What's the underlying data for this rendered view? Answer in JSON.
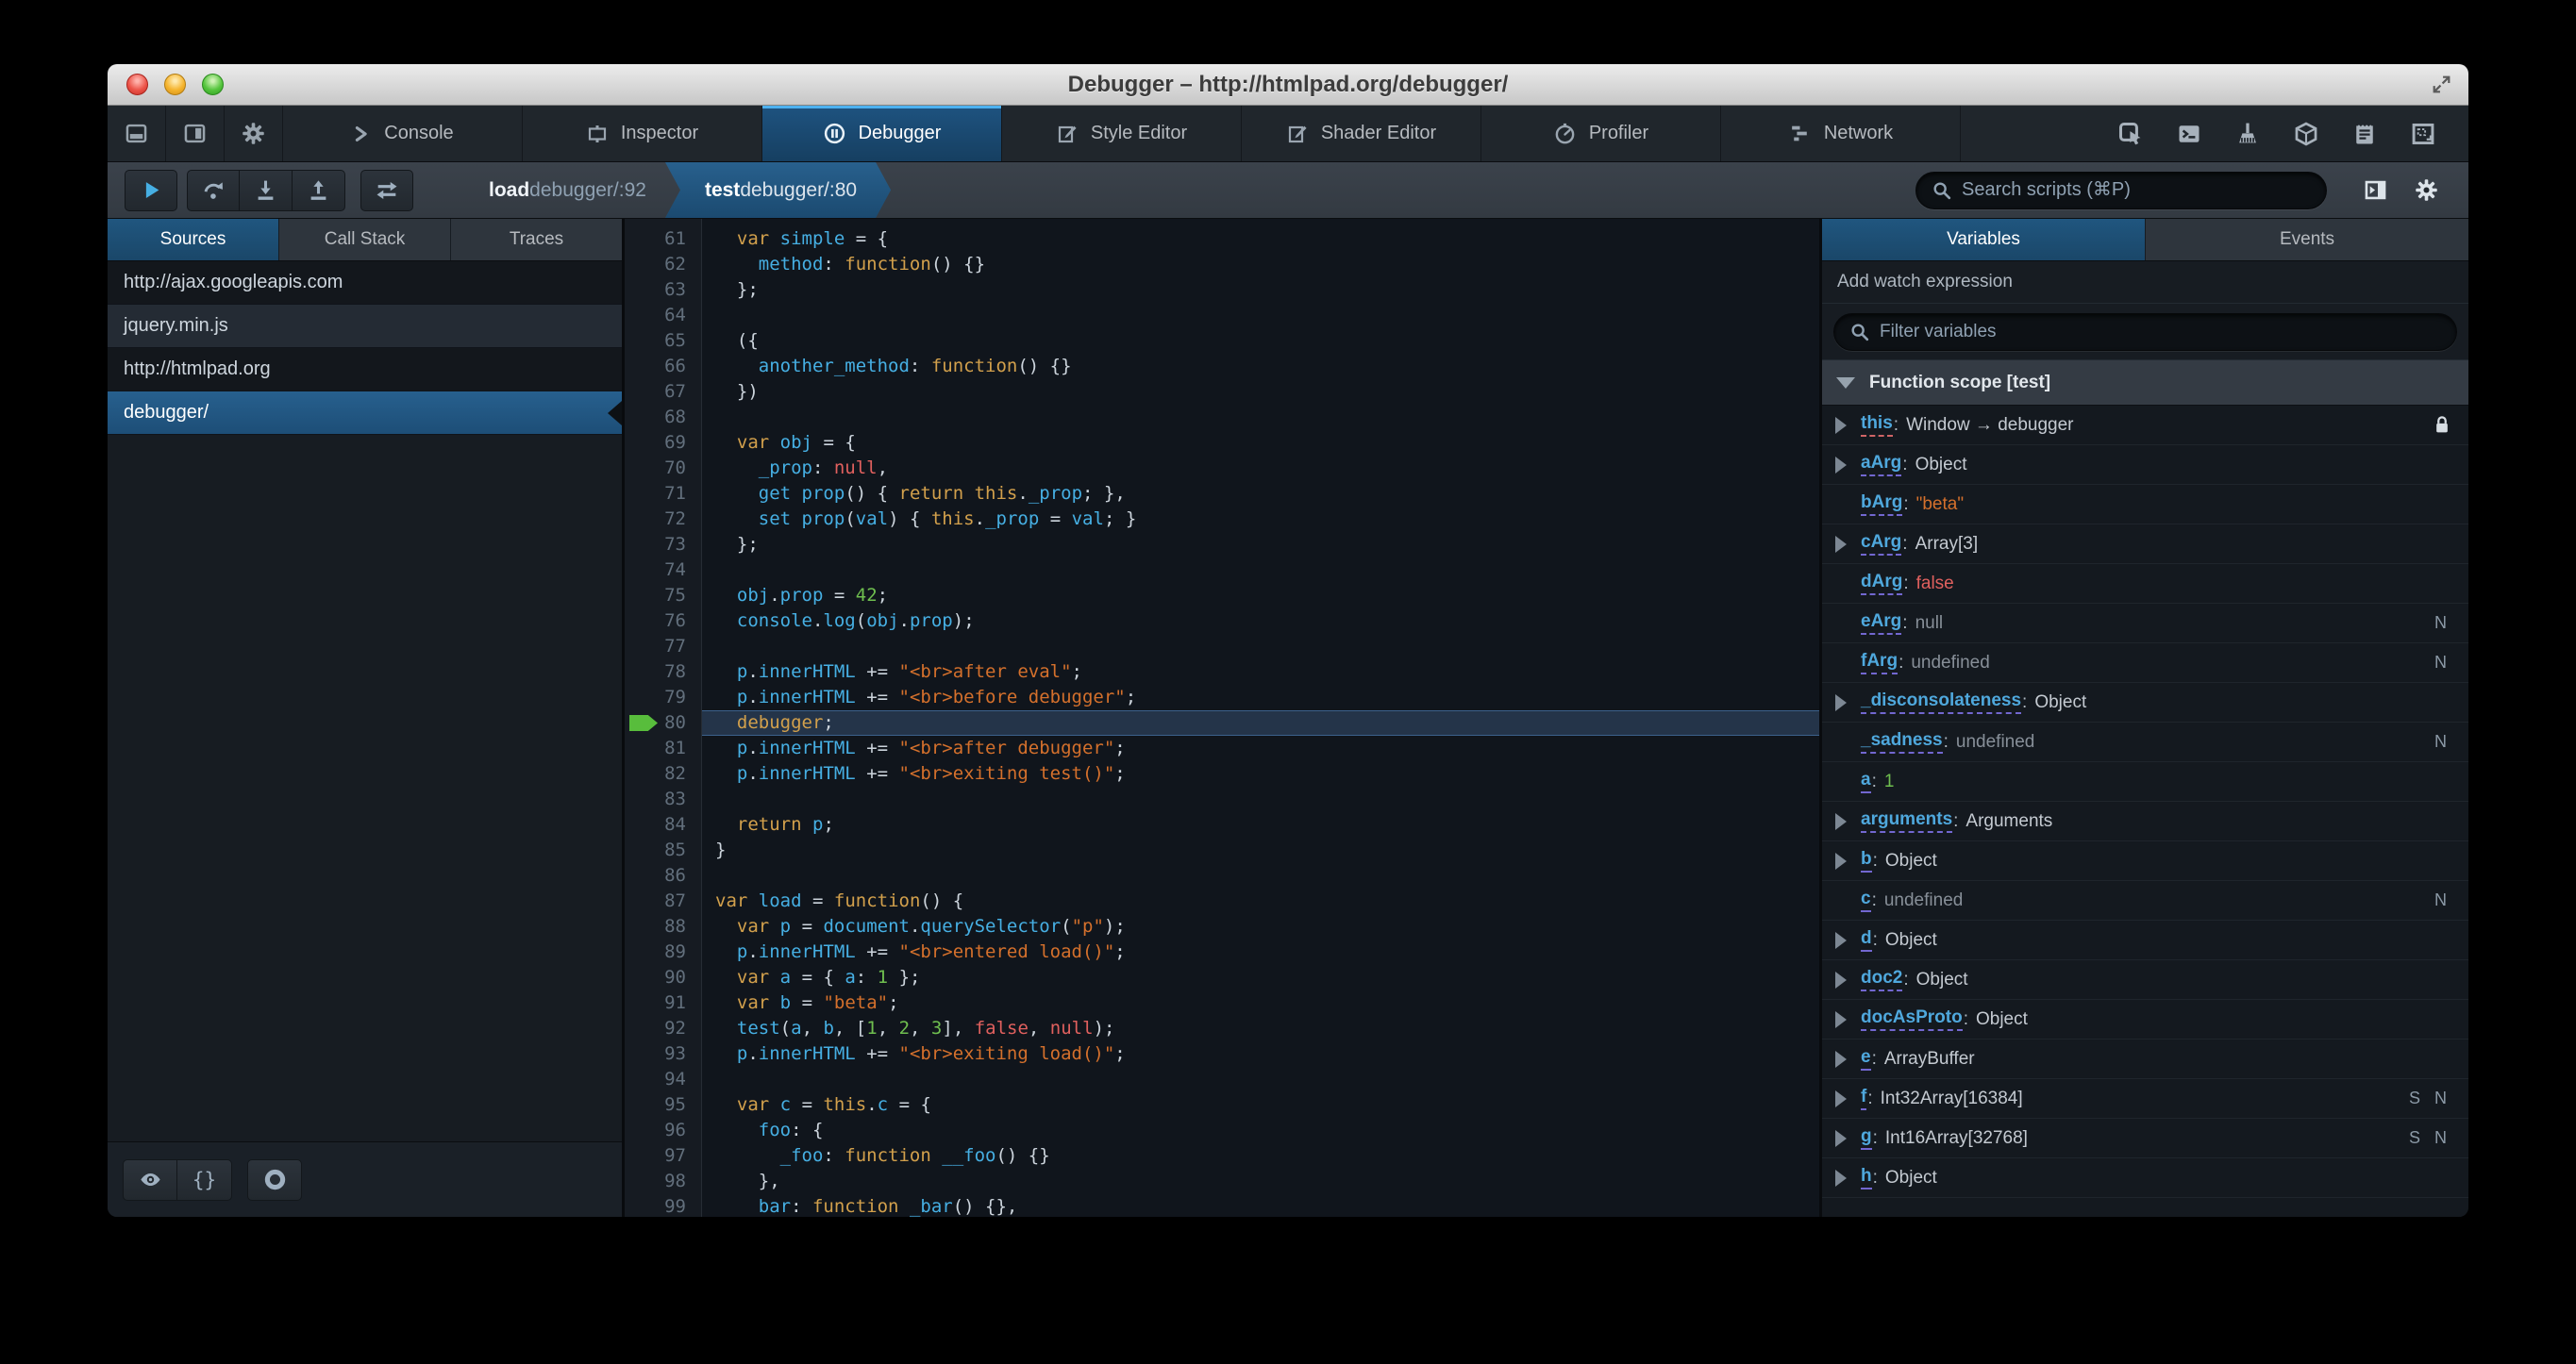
{
  "window": {
    "title": "Debugger – http://htmlpad.org/debugger/"
  },
  "colors": {
    "accent_blue": "#46afe3",
    "selection_blue": "#1d4f73",
    "active_tab_stripe": "#4cb1f0",
    "keyword": "#d2a04c",
    "identifier": "#46afe3",
    "string": "#d4702c",
    "atom": "#e0605e",
    "number": "#6fbf4f",
    "breakpoint_arrow_green": "#58bd3c",
    "editor_bg": "#10151c"
  },
  "toolbox": {
    "left_buttons": [
      {
        "name": "dock-bottom-button",
        "icon": "dock-bottom-icon"
      },
      {
        "name": "dock-side-button",
        "icon": "dock-side-icon"
      },
      {
        "name": "toolbox-options-button",
        "icon": "gear-icon"
      }
    ],
    "tabs": [
      {
        "label": "Console",
        "icon": "console-icon",
        "active": false
      },
      {
        "label": "Inspector",
        "icon": "inspector-icon",
        "active": false
      },
      {
        "label": "Debugger",
        "icon": "debugger-icon",
        "active": true
      },
      {
        "label": "Style Editor",
        "icon": "style-editor-icon",
        "active": false
      },
      {
        "label": "Shader Editor",
        "icon": "shader-editor-icon",
        "active": false
      },
      {
        "label": "Profiler",
        "icon": "profiler-icon",
        "active": false
      },
      {
        "label": "Network",
        "icon": "network-icon",
        "active": false
      }
    ],
    "right_buttons": [
      {
        "name": "element-picker-button",
        "icon": "element-picker-icon"
      },
      {
        "name": "split-console-button",
        "icon": "split-console-icon"
      },
      {
        "name": "paintbrush-button",
        "icon": "paintbrush-icon"
      },
      {
        "name": "tilt-3d-button",
        "icon": "cube-icon"
      },
      {
        "name": "scratchpad-button",
        "icon": "scratchpad-icon"
      },
      {
        "name": "responsive-mode-button",
        "icon": "responsive-icon"
      }
    ]
  },
  "debugger_toolbar": {
    "breadcrumbs": [
      {
        "fn": "load",
        "loc": " debugger/:92",
        "active": false
      },
      {
        "fn": "test",
        "loc": " debugger/:80",
        "active": true
      }
    ],
    "search_placeholder": "Search scripts (⌘P)"
  },
  "sources_panel": {
    "tabs": [
      {
        "label": "Sources",
        "active": true
      },
      {
        "label": "Call Stack",
        "active": false
      },
      {
        "label": "Traces",
        "active": false
      }
    ],
    "items": [
      {
        "label": "http://ajax.googleapis.com",
        "kind": "group",
        "selected": false
      },
      {
        "label": "jquery.min.js",
        "kind": "item",
        "selected": false
      },
      {
        "label": "http://htmlpad.org",
        "kind": "group",
        "selected": false
      },
      {
        "label": "debugger/",
        "kind": "item",
        "selected": true
      }
    ]
  },
  "editor": {
    "first_line": 61,
    "current_line": 80,
    "lines": [
      [
        [
          "t",
          "  "
        ],
        [
          "k",
          "var"
        ],
        [
          "t",
          " "
        ],
        [
          "d",
          "simple"
        ],
        [
          "t",
          " = {"
        ]
      ],
      [
        [
          "t",
          "    "
        ],
        [
          "d",
          "method"
        ],
        [
          "t",
          ": "
        ],
        [
          "k",
          "function"
        ],
        [
          "t",
          "() {}"
        ]
      ],
      [
        [
          "t",
          "  };"
        ]
      ],
      [],
      [
        [
          "t",
          "  ({"
        ]
      ],
      [
        [
          "t",
          "    "
        ],
        [
          "d",
          "another_method"
        ],
        [
          "t",
          ": "
        ],
        [
          "k",
          "function"
        ],
        [
          "t",
          "() {}"
        ]
      ],
      [
        [
          "t",
          "  })"
        ]
      ],
      [],
      [
        [
          "t",
          "  "
        ],
        [
          "k",
          "var"
        ],
        [
          "t",
          " "
        ],
        [
          "d",
          "obj"
        ],
        [
          "t",
          " = {"
        ]
      ],
      [
        [
          "t",
          "    "
        ],
        [
          "d",
          "_prop"
        ],
        [
          "t",
          ": "
        ],
        [
          "a",
          "null"
        ],
        [
          "t",
          ","
        ]
      ],
      [
        [
          "t",
          "    "
        ],
        [
          "d",
          "get"
        ],
        [
          "t",
          " "
        ],
        [
          "d",
          "prop"
        ],
        [
          "t",
          "() { "
        ],
        [
          "k",
          "return"
        ],
        [
          "t",
          " "
        ],
        [
          "k",
          "this"
        ],
        [
          "t",
          "."
        ],
        [
          "d",
          "_prop"
        ],
        [
          "t",
          "; },"
        ]
      ],
      [
        [
          "t",
          "    "
        ],
        [
          "d",
          "set"
        ],
        [
          "t",
          " "
        ],
        [
          "d",
          "prop"
        ],
        [
          "t",
          "("
        ],
        [
          "d",
          "val"
        ],
        [
          "t",
          ") { "
        ],
        [
          "k",
          "this"
        ],
        [
          "t",
          "."
        ],
        [
          "d",
          "_prop"
        ],
        [
          "t",
          " = "
        ],
        [
          "d",
          "val"
        ],
        [
          "t",
          "; }"
        ]
      ],
      [
        [
          "t",
          "  };"
        ]
      ],
      [],
      [
        [
          "t",
          "  "
        ],
        [
          "d",
          "obj"
        ],
        [
          "t",
          "."
        ],
        [
          "d",
          "prop"
        ],
        [
          "t",
          " = "
        ],
        [
          "n",
          "42"
        ],
        [
          "t",
          ";"
        ]
      ],
      [
        [
          "t",
          "  "
        ],
        [
          "d",
          "console"
        ],
        [
          "t",
          "."
        ],
        [
          "d",
          "log"
        ],
        [
          "t",
          "("
        ],
        [
          "d",
          "obj"
        ],
        [
          "t",
          "."
        ],
        [
          "d",
          "prop"
        ],
        [
          "t",
          ");"
        ]
      ],
      [],
      [
        [
          "t",
          "  "
        ],
        [
          "d",
          "p"
        ],
        [
          "t",
          "."
        ],
        [
          "d",
          "innerHTML"
        ],
        [
          "t",
          " += "
        ],
        [
          "s",
          "\"<br>after eval\""
        ],
        [
          "t",
          ";"
        ]
      ],
      [
        [
          "t",
          "  "
        ],
        [
          "d",
          "p"
        ],
        [
          "t",
          "."
        ],
        [
          "d",
          "innerHTML"
        ],
        [
          "t",
          " += "
        ],
        [
          "s",
          "\"<br>before debugger\""
        ],
        [
          "t",
          ";"
        ]
      ],
      [
        [
          "t",
          "  "
        ],
        [
          "k",
          "debugger"
        ],
        [
          "t",
          ";"
        ]
      ],
      [
        [
          "t",
          "  "
        ],
        [
          "d",
          "p"
        ],
        [
          "t",
          "."
        ],
        [
          "d",
          "innerHTML"
        ],
        [
          "t",
          " += "
        ],
        [
          "s",
          "\"<br>after debugger\""
        ],
        [
          "t",
          ";"
        ]
      ],
      [
        [
          "t",
          "  "
        ],
        [
          "d",
          "p"
        ],
        [
          "t",
          "."
        ],
        [
          "d",
          "innerHTML"
        ],
        [
          "t",
          " += "
        ],
        [
          "s",
          "\"<br>exiting test()\""
        ],
        [
          "t",
          ";"
        ]
      ],
      [],
      [
        [
          "t",
          "  "
        ],
        [
          "k",
          "return"
        ],
        [
          "t",
          " "
        ],
        [
          "d",
          "p"
        ],
        [
          "t",
          ";"
        ]
      ],
      [
        [
          "t",
          "}"
        ]
      ],
      [],
      [
        [
          "k",
          "var"
        ],
        [
          "t",
          " "
        ],
        [
          "d",
          "load"
        ],
        [
          "t",
          " = "
        ],
        [
          "k",
          "function"
        ],
        [
          "t",
          "() {"
        ]
      ],
      [
        [
          "t",
          "  "
        ],
        [
          "k",
          "var"
        ],
        [
          "t",
          " "
        ],
        [
          "d",
          "p"
        ],
        [
          "t",
          " = "
        ],
        [
          "d",
          "document"
        ],
        [
          "t",
          "."
        ],
        [
          "d",
          "querySelector"
        ],
        [
          "t",
          "("
        ],
        [
          "s",
          "\"p\""
        ],
        [
          "t",
          ");"
        ]
      ],
      [
        [
          "t",
          "  "
        ],
        [
          "d",
          "p"
        ],
        [
          "t",
          "."
        ],
        [
          "d",
          "innerHTML"
        ],
        [
          "t",
          " += "
        ],
        [
          "s",
          "\"<br>entered load()\""
        ],
        [
          "t",
          ";"
        ]
      ],
      [
        [
          "t",
          "  "
        ],
        [
          "k",
          "var"
        ],
        [
          "t",
          " "
        ],
        [
          "d",
          "a"
        ],
        [
          "t",
          " = { "
        ],
        [
          "d",
          "a"
        ],
        [
          "t",
          ": "
        ],
        [
          "n",
          "1"
        ],
        [
          "t",
          " };"
        ]
      ],
      [
        [
          "t",
          "  "
        ],
        [
          "k",
          "var"
        ],
        [
          "t",
          " "
        ],
        [
          "d",
          "b"
        ],
        [
          "t",
          " = "
        ],
        [
          "s",
          "\"beta\""
        ],
        [
          "t",
          ";"
        ]
      ],
      [
        [
          "t",
          "  "
        ],
        [
          "d",
          "test"
        ],
        [
          "t",
          "("
        ],
        [
          "d",
          "a"
        ],
        [
          "t",
          ", "
        ],
        [
          "d",
          "b"
        ],
        [
          "t",
          ", ["
        ],
        [
          "n",
          "1"
        ],
        [
          "t",
          ", "
        ],
        [
          "n",
          "2"
        ],
        [
          "t",
          ", "
        ],
        [
          "n",
          "3"
        ],
        [
          "t",
          "], "
        ],
        [
          "a",
          "false"
        ],
        [
          "t",
          ", "
        ],
        [
          "a",
          "null"
        ],
        [
          "t",
          ");"
        ]
      ],
      [
        [
          "t",
          "  "
        ],
        [
          "d",
          "p"
        ],
        [
          "t",
          "."
        ],
        [
          "d",
          "innerHTML"
        ],
        [
          "t",
          " += "
        ],
        [
          "s",
          "\"<br>exiting load()\""
        ],
        [
          "t",
          ";"
        ]
      ],
      [],
      [
        [
          "t",
          "  "
        ],
        [
          "k",
          "var"
        ],
        [
          "t",
          " "
        ],
        [
          "d",
          "c"
        ],
        [
          "t",
          " = "
        ],
        [
          "k",
          "this"
        ],
        [
          "t",
          "."
        ],
        [
          "d",
          "c"
        ],
        [
          "t",
          " = {"
        ]
      ],
      [
        [
          "t",
          "    "
        ],
        [
          "d",
          "foo"
        ],
        [
          "t",
          ": {"
        ]
      ],
      [
        [
          "t",
          "      "
        ],
        [
          "d",
          "_foo"
        ],
        [
          "t",
          ": "
        ],
        [
          "k",
          "function"
        ],
        [
          "t",
          " "
        ],
        [
          "d",
          "__foo"
        ],
        [
          "t",
          "() {}"
        ]
      ],
      [
        [
          "t",
          "    },"
        ]
      ],
      [
        [
          "t",
          "    "
        ],
        [
          "d",
          "bar"
        ],
        [
          "t",
          ": "
        ],
        [
          "k",
          "function"
        ],
        [
          "t",
          " "
        ],
        [
          "d",
          "_bar"
        ],
        [
          "t",
          "() {},"
        ]
      ]
    ]
  },
  "variables_panel": {
    "tabs": [
      {
        "label": "Variables",
        "active": true
      },
      {
        "label": "Events",
        "active": false
      }
    ],
    "watch_label": "Add watch expression",
    "filter_placeholder": "Filter variables",
    "scope_header": "Function scope [test]",
    "variables": [
      {
        "name": "this",
        "value": "Window → debugger",
        "vclass": "plain",
        "arrow": true,
        "lock": true,
        "badges": "",
        "underline": "pink"
      },
      {
        "name": "aArg",
        "value": "Object",
        "vclass": "plain",
        "arrow": true,
        "lock": false,
        "badges": ""
      },
      {
        "name": "bArg",
        "value": "\"beta\"",
        "vclass": "string",
        "arrow": false,
        "lock": false,
        "badges": ""
      },
      {
        "name": "cArg",
        "value": "Array[3]",
        "vclass": "plain",
        "arrow": true,
        "lock": false,
        "badges": ""
      },
      {
        "name": "dArg",
        "value": "false",
        "vclass": "atom",
        "arrow": false,
        "lock": false,
        "badges": ""
      },
      {
        "name": "eArg",
        "value": "null",
        "vclass": "dim",
        "arrow": false,
        "lock": false,
        "badges": "N"
      },
      {
        "name": "fArg",
        "value": "undefined",
        "vclass": "dim",
        "arrow": false,
        "lock": false,
        "badges": "N"
      },
      {
        "name": "_disconsolateness",
        "value": "Object",
        "vclass": "plain",
        "arrow": true,
        "lock": false,
        "badges": ""
      },
      {
        "name": "_sadness",
        "value": "undefined",
        "vclass": "dim",
        "arrow": false,
        "lock": false,
        "badges": "N"
      },
      {
        "name": "a",
        "value": "1",
        "vclass": "number",
        "arrow": false,
        "lock": false,
        "badges": ""
      },
      {
        "name": "arguments",
        "value": "Arguments",
        "vclass": "plain",
        "arrow": true,
        "lock": false,
        "badges": ""
      },
      {
        "name": "b",
        "value": "Object",
        "vclass": "plain",
        "arrow": true,
        "lock": false,
        "badges": ""
      },
      {
        "name": "c",
        "value": "undefined",
        "vclass": "dim",
        "arrow": false,
        "lock": false,
        "badges": "N"
      },
      {
        "name": "d",
        "value": "Object",
        "vclass": "plain",
        "arrow": true,
        "lock": false,
        "badges": ""
      },
      {
        "name": "doc2",
        "value": "Object",
        "vclass": "plain",
        "arrow": true,
        "lock": false,
        "badges": ""
      },
      {
        "name": "docAsProto",
        "value": "Object",
        "vclass": "plain",
        "arrow": true,
        "lock": false,
        "badges": ""
      },
      {
        "name": "e",
        "value": "ArrayBuffer",
        "vclass": "plain",
        "arrow": true,
        "lock": false,
        "badges": ""
      },
      {
        "name": "f",
        "value": "Int32Array[16384]",
        "vclass": "plain",
        "arrow": true,
        "lock": false,
        "badges": "S N"
      },
      {
        "name": "g",
        "value": "Int16Array[32768]",
        "vclass": "plain",
        "arrow": true,
        "lock": false,
        "badges": "S N"
      },
      {
        "name": "h",
        "value": "Object",
        "vclass": "plain",
        "arrow": true,
        "lock": false,
        "badges": ""
      }
    ]
  }
}
